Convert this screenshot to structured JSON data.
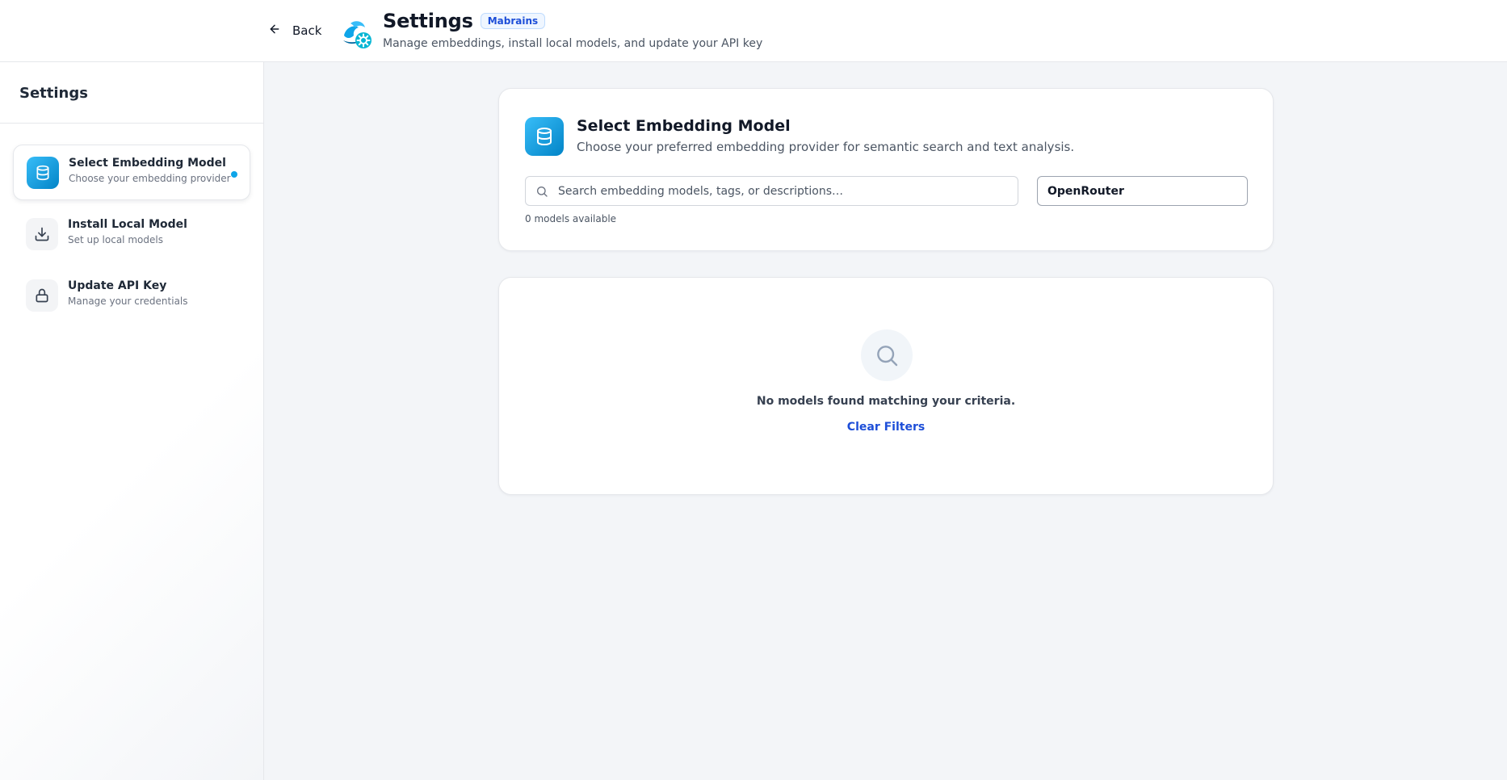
{
  "header": {
    "back_label": "Back",
    "title": "Settings",
    "badge": "Mabrains",
    "subtitle": "Manage embeddings, install local models, and update your API key"
  },
  "sidebar": {
    "title": "Settings",
    "items": [
      {
        "label": "Select Embedding Model",
        "description": "Choose your embedding provider",
        "icon": "database-icon",
        "active": true
      },
      {
        "label": "Install Local Model",
        "description": "Set up local models",
        "icon": "download-icon",
        "active": false
      },
      {
        "label": "Update API Key",
        "description": "Manage your credentials",
        "icon": "lock-icon",
        "active": false
      }
    ]
  },
  "main": {
    "card": {
      "title": "Select Embedding Model",
      "description": "Choose your preferred embedding provider for semantic search and text analysis.",
      "search_placeholder": "Search embedding models, tags, or descriptions…",
      "search_value": "",
      "provider_selected": "OpenRouter",
      "models_count": "0 models available"
    },
    "empty_state": {
      "message": "No models found matching your criteria.",
      "clear_label": "Clear Filters"
    }
  },
  "colors": {
    "accent": "#0ea5e9",
    "accent_dark": "#0284c7",
    "link": "#1d4ed8",
    "page_bg": "#f3f5f8"
  }
}
